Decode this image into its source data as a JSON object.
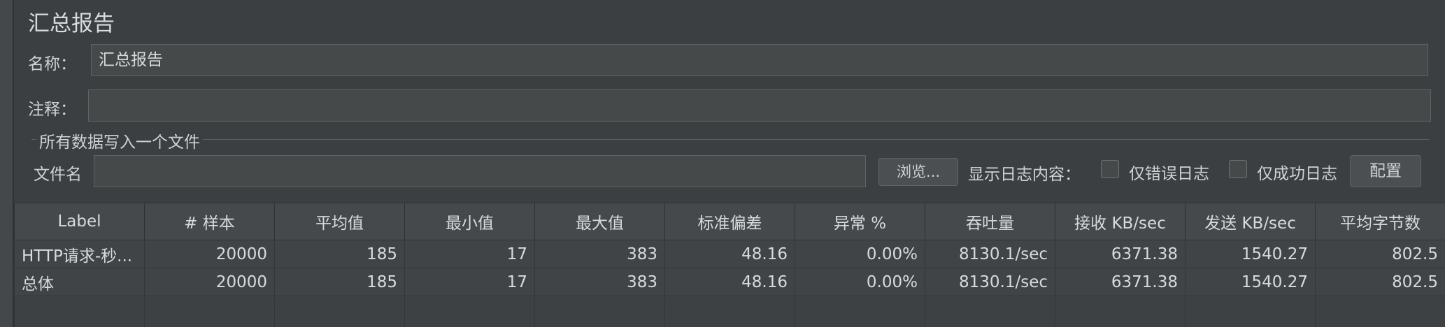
{
  "title": "汇总报告",
  "name_label": "名称：",
  "name_value": "汇总报告",
  "comment_label": "注释：",
  "comment_value": "",
  "file_group_title": "所有数据写入一个文件",
  "file_label": "文件名",
  "file_value": "",
  "browse_button": "浏览...",
  "log_content_label": "显示日志内容：",
  "errors_only_label": "仅错误日志",
  "success_only_label": "仅成功日志",
  "config_button": "配置",
  "table": {
    "headers": [
      "Label",
      "# 样本",
      "平均值",
      "最小值",
      "最大值",
      "标准偏差",
      "异常 %",
      "吞吐量",
      "接收 KB/sec",
      "发送 KB/sec",
      "平均字节数"
    ],
    "rows": [
      [
        "HTTP请求-秒...",
        "20000",
        "185",
        "17",
        "383",
        "48.16",
        "0.00%",
        "8130.1/sec",
        "6371.38",
        "1540.27",
        "802.5"
      ],
      [
        "总体",
        "20000",
        "185",
        "17",
        "383",
        "48.16",
        "0.00%",
        "8130.1/sec",
        "6371.38",
        "1540.27",
        "802.5"
      ]
    ]
  }
}
